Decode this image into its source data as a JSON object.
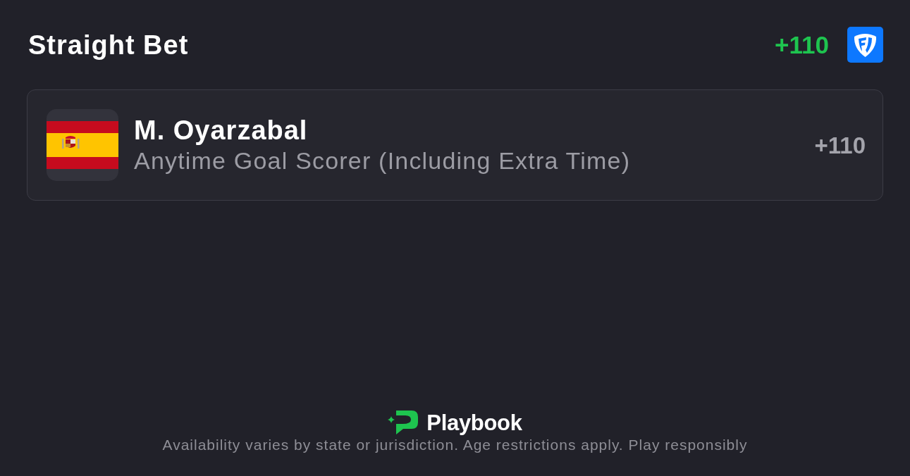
{
  "header": {
    "title": "Straight Bet",
    "odds": "+110"
  },
  "selections": [
    {
      "player": "M. Oyarzabal",
      "market": "Anytime Goal Scorer (Including Extra Time)",
      "odds": "+110"
    }
  ],
  "footer": {
    "brand": "Playbook",
    "disclaimer": "Availability varies by state or jurisdiction. Age restrictions apply. Play responsibly"
  }
}
